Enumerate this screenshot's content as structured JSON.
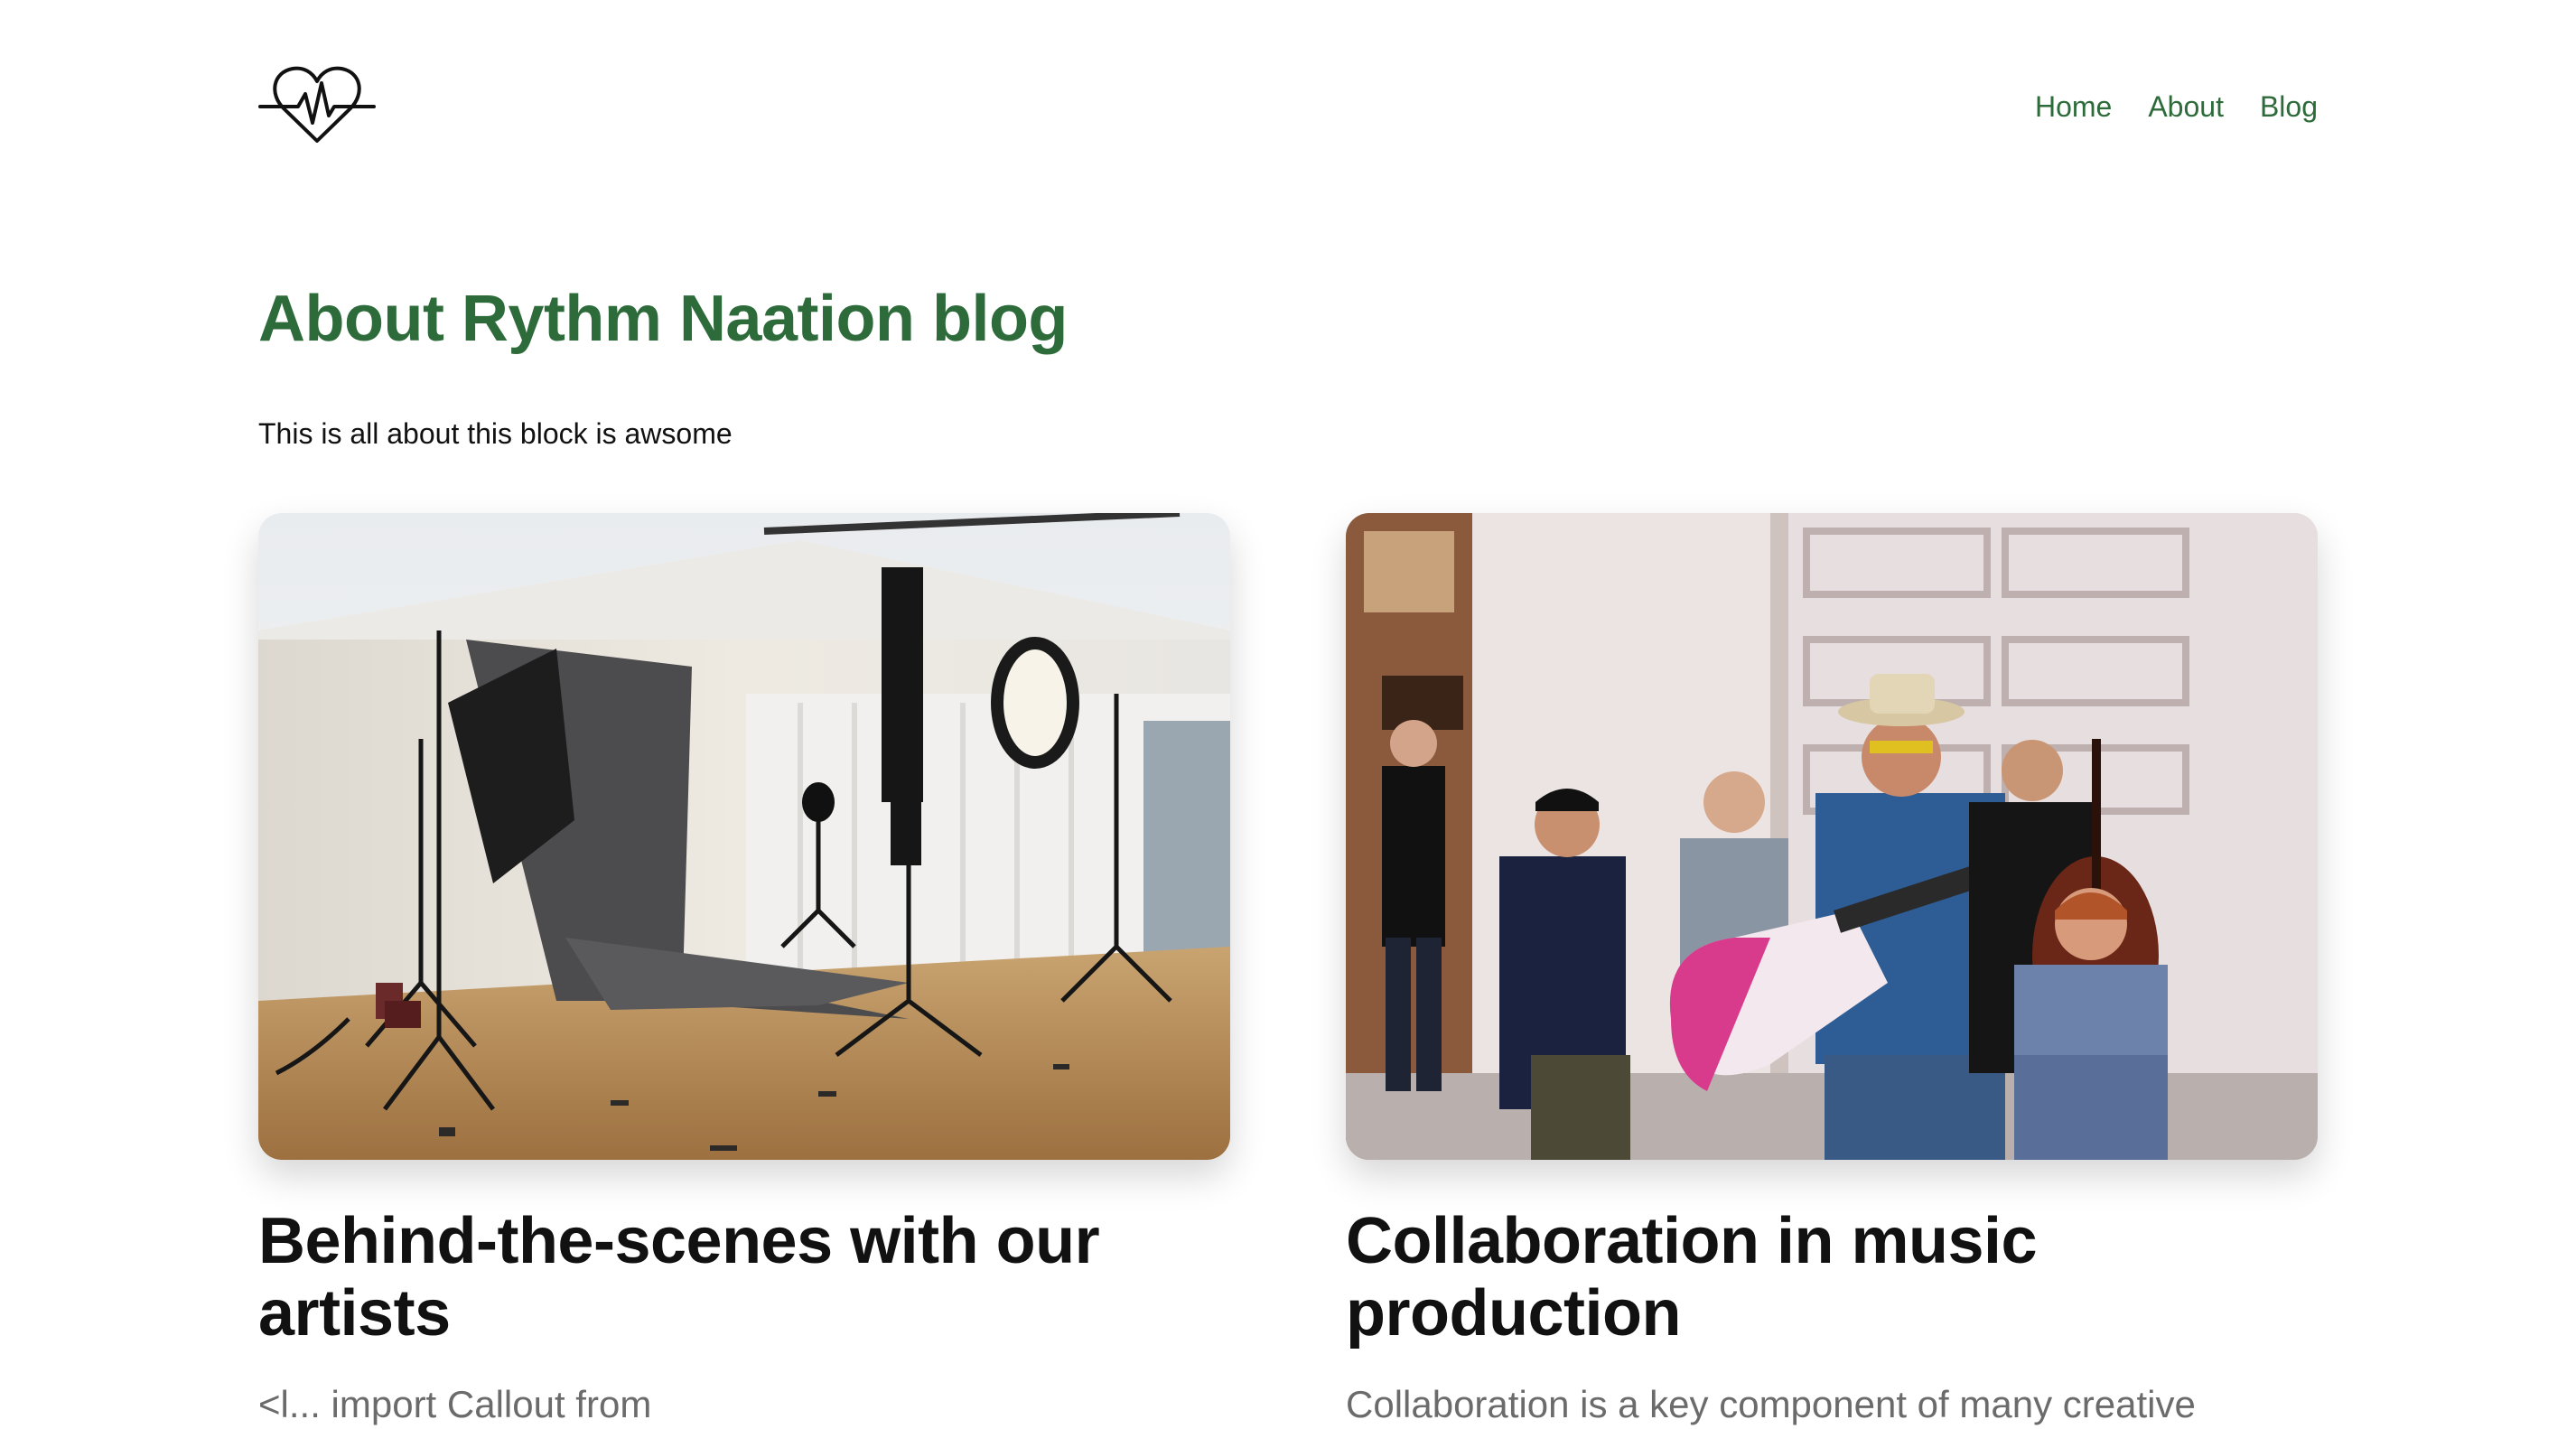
{
  "header": {
    "logo_icon": "heartbeat-heart-icon",
    "nav": [
      {
        "label": "Home"
      },
      {
        "label": "About"
      },
      {
        "label": "Blog"
      }
    ]
  },
  "main": {
    "title": "About Rythm Naation blog",
    "intro": "This is all about this block is awsome",
    "posts": [
      {
        "title": "Behind-the-scenes with our artists",
        "excerpt": "<l... import Callout from",
        "image": "photo-studio-with-lighting-equipment"
      },
      {
        "title": "Collaboration in music production",
        "excerpt": "Collaboration is a key component of many creative",
        "image": "street-musicians-band-playing"
      }
    ]
  },
  "colors": {
    "accent": "#2e6b3a",
    "text": "#111111",
    "muted": "#6b6b6b"
  }
}
